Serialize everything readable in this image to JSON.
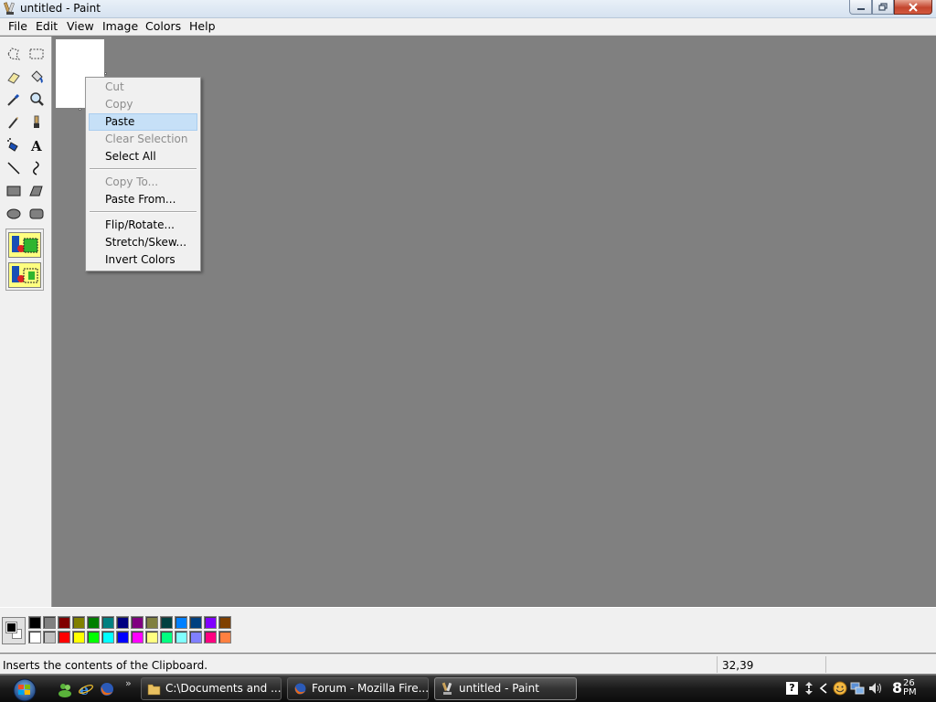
{
  "window": {
    "title": "untitled - Paint"
  },
  "menubar": [
    "File",
    "Edit",
    "View",
    "Image",
    "Colors",
    "Help"
  ],
  "context_menu": {
    "items": [
      {
        "label": "Cut",
        "enabled": false
      },
      {
        "label": "Copy",
        "enabled": false
      },
      {
        "label": "Paste",
        "enabled": true,
        "highlighted": true
      },
      {
        "label": "Clear Selection",
        "enabled": false
      },
      {
        "label": "Select All",
        "enabled": true
      },
      {
        "label": "Copy To...",
        "enabled": false
      },
      {
        "label": "Paste From...",
        "enabled": true
      },
      {
        "label": "Flip/Rotate...",
        "enabled": true
      },
      {
        "label": "Stretch/Skew...",
        "enabled": true
      },
      {
        "label": "Invert Colors",
        "enabled": true
      }
    ]
  },
  "tools": [
    "free-form-select-icon",
    "select-icon",
    "eraser-icon",
    "fill-icon",
    "pick-color-icon",
    "magnifier-icon",
    "pencil-icon",
    "brush-icon",
    "airbrush-icon",
    "text-icon",
    "line-icon",
    "curve-icon",
    "rectangle-icon",
    "polygon-icon",
    "ellipse-icon",
    "rounded-rectangle-icon"
  ],
  "palette": {
    "foreground": "#000000",
    "background": "#ffffff",
    "row1": [
      "#000000",
      "#808080",
      "#800000",
      "#808000",
      "#008000",
      "#008080",
      "#000080",
      "#800080",
      "#808040",
      "#004040",
      "#0080ff",
      "#004080",
      "#8000ff",
      "#804000"
    ],
    "row2": [
      "#ffffff",
      "#c0c0c0",
      "#ff0000",
      "#ffff00",
      "#00ff00",
      "#00ffff",
      "#0000ff",
      "#ff00ff",
      "#ffff80",
      "#00ff80",
      "#80ffff",
      "#8080ff",
      "#ff0080",
      "#ff8040"
    ]
  },
  "status": {
    "text": "Inserts the contents of the Clipboard.",
    "coords": "32,39"
  },
  "taskbar": {
    "buttons": [
      {
        "label": "C:\\Documents and ...",
        "active": false
      },
      {
        "label": "Forum - Mozilla Fire...",
        "active": false
      },
      {
        "label": "untitled - Paint",
        "active": true
      }
    ],
    "clock_hour": "8",
    "clock_minute": "26",
    "clock_ampm": "PM"
  }
}
